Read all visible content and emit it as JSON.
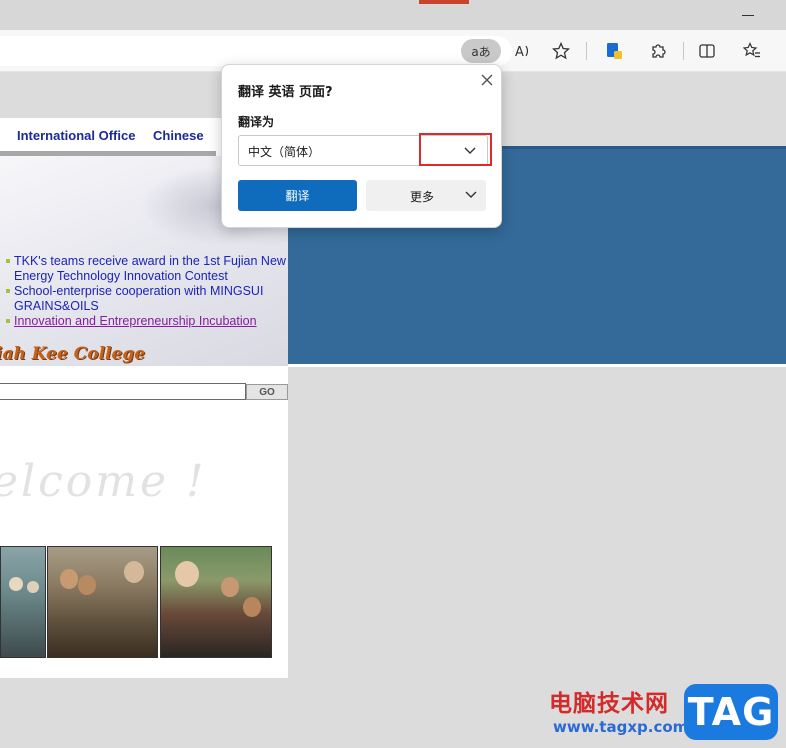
{
  "browser": {
    "reader_button_label": "aあ",
    "icons": [
      "read-aloud-icon",
      "favorite-star-icon",
      "extension-puzzle-icon",
      "split-screen-icon",
      "favorites-list-icon",
      "translate-extension-icon"
    ]
  },
  "page": {
    "nav_links": [
      "International Office",
      "Chinese"
    ],
    "news": [
      "TKK's teams receive award in the 1st Fujian New Energy Technology Innovation Contest",
      "School-enterprise cooperation with MINGSUI GRAINS&OILS",
      "Innovation and Entrepreneurship Incubation"
    ],
    "college_name": "iah Kee College",
    "search_button_label": "GO",
    "welcome_text": "elcome !"
  },
  "translate_dialog": {
    "title": "翻译 英语 页面?",
    "translate_to_label": "翻译为",
    "selected_language": "中文（简体）",
    "translate_button": "翻译",
    "more_button": "更多"
  },
  "watermark": {
    "site_name": "电脑技术网",
    "url": "www.tagxp.com",
    "badge": "TAG"
  },
  "colors": {
    "primary_button": "#0f6cbd",
    "highlight_box": "#e02a2a",
    "blue_panel": "#336a9a",
    "link": "#1a24b8",
    "visited_link": "#8a1aa0"
  }
}
